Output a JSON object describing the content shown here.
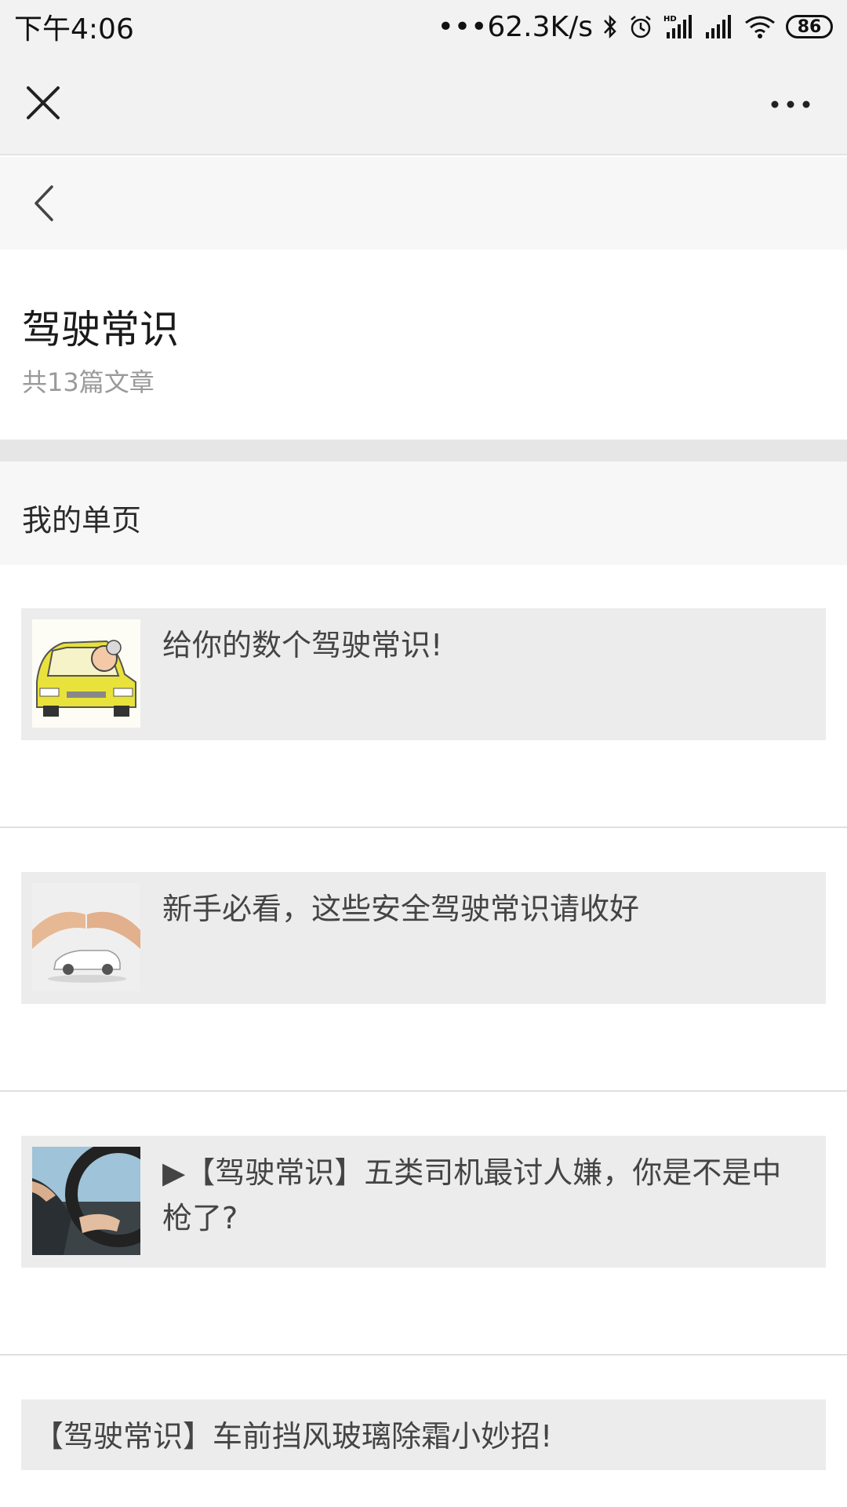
{
  "status_bar": {
    "time": "下午4:06",
    "network_speed": "•••62.3K/s",
    "battery": "86",
    "icons": [
      "bluetooth-icon",
      "alarm-icon",
      "hd-signal-icon",
      "signal-icon",
      "wifi-icon",
      "battery-icon"
    ]
  },
  "header": {
    "title": "驾驶常识",
    "count": "共13篇文章"
  },
  "section": {
    "label": "我的单页"
  },
  "articles": [
    {
      "title": "给你的数个驾驶常识!",
      "thumb": "cartoon-car-thumbnail"
    },
    {
      "title": "新手必看，这些安全驾驶常识请收好",
      "thumb": "hands-over-car-thumbnail"
    },
    {
      "title": "▶【驾驶常识】五类司机最讨人嫌，你是不是中枪了?",
      "thumb": "steering-wheel-thumbnail"
    },
    {
      "title": "【驾驶常识】车前挡风玻璃除霜小妙招!"
    }
  ],
  "colors": {
    "bar_bg": "#f2f2f2",
    "card_bg": "#ececec",
    "muted_text": "#9a9a9a"
  }
}
